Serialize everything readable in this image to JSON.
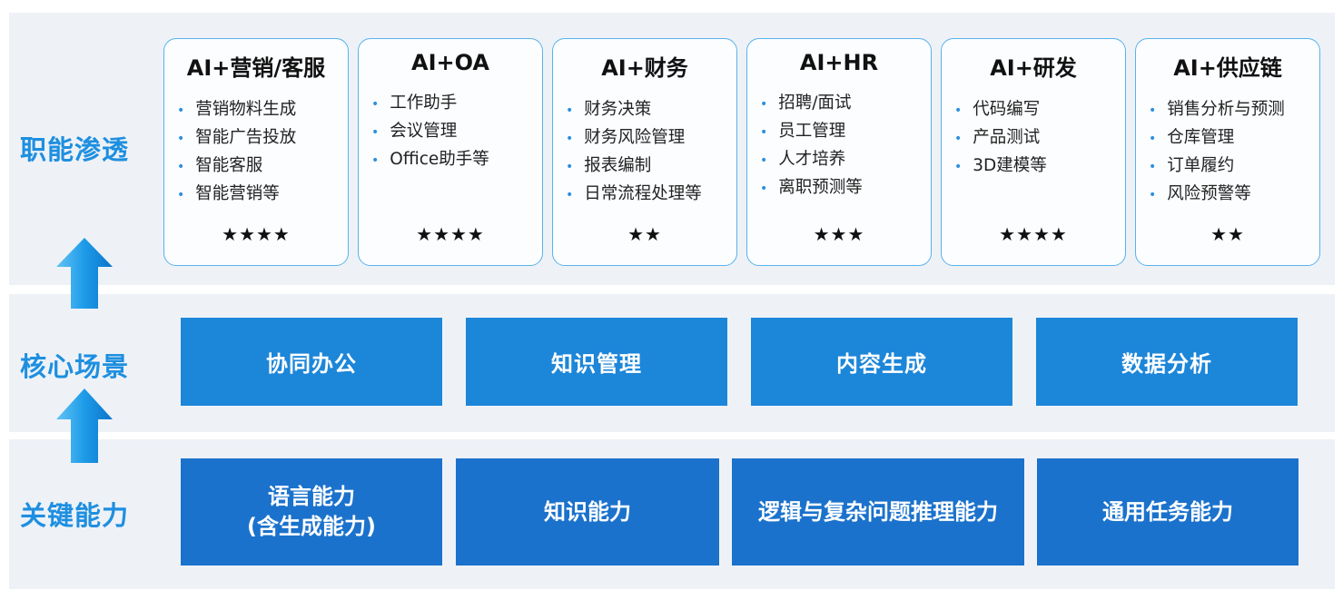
{
  "row_labels": {
    "functions": "职能渗透",
    "scenarios": "核心场景",
    "capabilities": "关键能力"
  },
  "cards": [
    {
      "title": "AI+营销/客服",
      "items": [
        "营销物料生成",
        "智能广告投放",
        "智能客服",
        "智能营销等"
      ],
      "stars": "★★★★"
    },
    {
      "title": "AI+OA",
      "items": [
        "工作助手",
        "会议管理",
        "Office助手等"
      ],
      "stars": "★★★★"
    },
    {
      "title": "AI+财务",
      "items": [
        "财务决策",
        "财务风险管理",
        "报表编制",
        "日常流程处理等"
      ],
      "stars": "★★"
    },
    {
      "title": "AI+HR",
      "items": [
        "招聘/面试",
        "员工管理",
        "人才培养",
        "离职预测等"
      ],
      "stars": "★★★"
    },
    {
      "title": "AI+研发",
      "items": [
        "代码编写",
        "产品测试",
        "3D建模等"
      ],
      "stars": "★★★★"
    },
    {
      "title": "AI+供应链",
      "items": [
        "销售分析与预测",
        "仓库管理",
        "订单履约",
        "风险预警等"
      ],
      "stars": "★★"
    }
  ],
  "scenarios": [
    "协同办公",
    "知识管理",
    "内容生成",
    "数据分析"
  ],
  "capabilities": [
    {
      "line1": "语言能力",
      "line2": "(含生成能力)"
    },
    {
      "line1": "知识能力",
      "line2": ""
    },
    {
      "line1": "逻辑与复杂问题推理能力",
      "line2": ""
    },
    {
      "line1": "通用任务能力",
      "line2": ""
    }
  ],
  "colors": {
    "label_blue": "#1e8fe0",
    "scenario_box": "#1c86d9",
    "capability_box": "#1b72cc",
    "card_border": "#59b2ec",
    "band_bg": "#eef2f7"
  }
}
